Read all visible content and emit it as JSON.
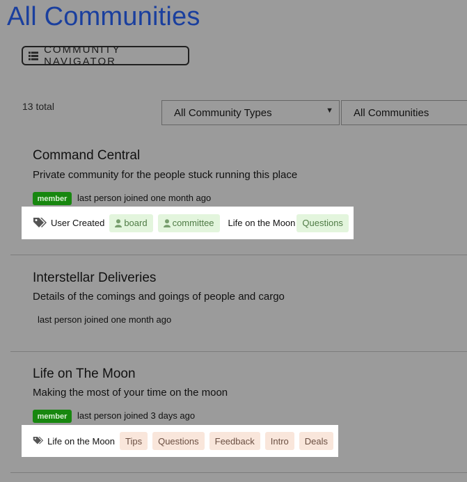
{
  "page": {
    "title": "All Communities",
    "navigator_label": "COMMUNITY NAVIGATOR",
    "total": "13 total",
    "filters": {
      "type": "All Community Types",
      "scope": "All Communities"
    }
  },
  "communities": [
    {
      "name": "Command Central",
      "description": "Private community for the people stuck running this place",
      "badge": "member",
      "joined": "last person joined one month ago",
      "tags": {
        "created": "User Created",
        "chips": [
          {
            "label": "board",
            "icon": "user-icon"
          },
          {
            "label": "committee",
            "icon": "user-icon"
          }
        ],
        "linked_label": "Life on the Moon",
        "linked_chips": [
          {
            "label": "Questions"
          }
        ]
      }
    },
    {
      "name": "Interstellar Deliveries",
      "description": "Details of the comings and goings of people and cargo",
      "joined": "last person joined one month ago"
    },
    {
      "name": "Life on The Moon",
      "description": "Making the most of your time on the moon",
      "badge": "member",
      "joined": "last person joined 3 days ago",
      "tags": {
        "linked_label": "Life on the Moon",
        "chips": [
          {
            "label": "Tips"
          },
          {
            "label": "Questions"
          },
          {
            "label": "Feedback"
          },
          {
            "label": "Intro"
          },
          {
            "label": "Deals"
          }
        ]
      }
    }
  ],
  "colors": {
    "title": "#1a3f9e",
    "member_badge": "#17870f",
    "chip_green": "#e3f5dd",
    "chip_peach": "#f9e6db",
    "background": "#9b9b9b"
  },
  "icons": {
    "navigator": "list-icon",
    "tag": "tag-icon",
    "user": "user-icon",
    "select": "chevron-down-icon"
  }
}
